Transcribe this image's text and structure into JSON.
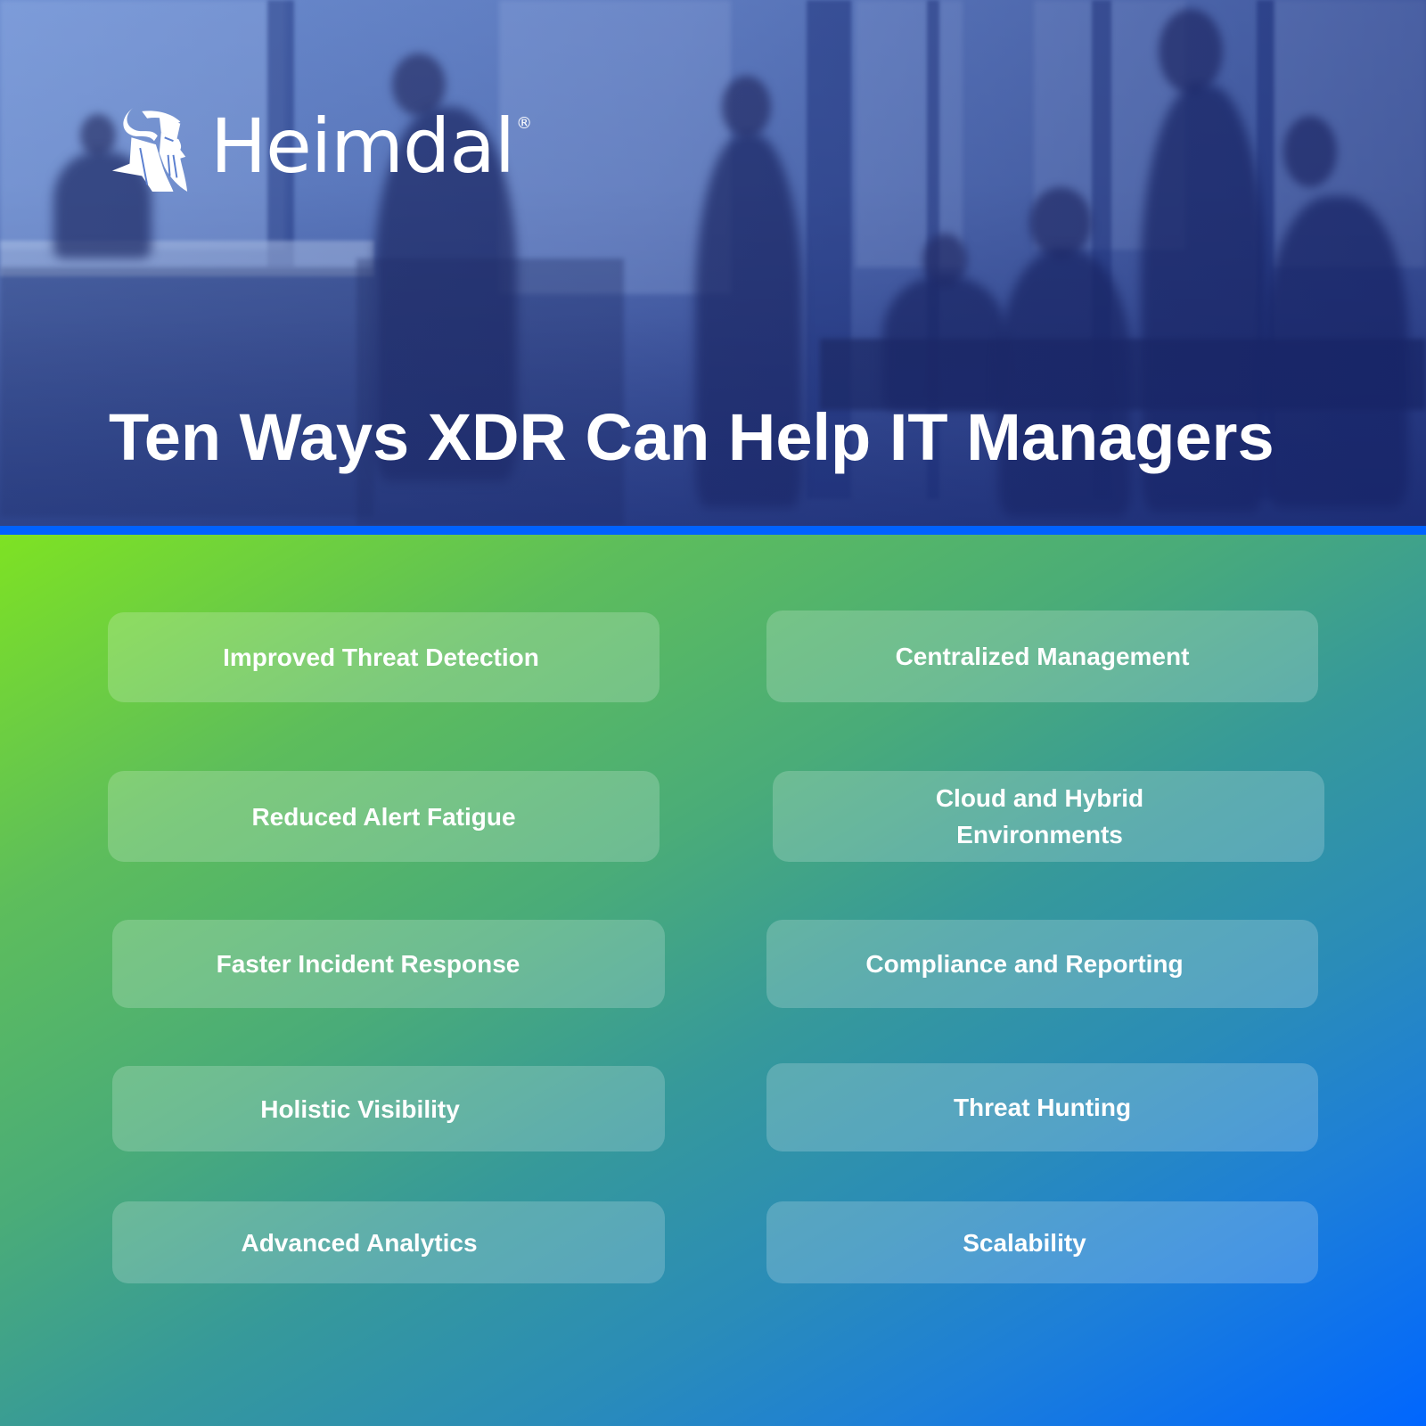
{
  "brand": {
    "name": "Heimdal",
    "registered_mark": "®",
    "logo_icon": "viking-head-icon"
  },
  "header": {
    "title": "Ten Ways XDR Can Help IT Managers"
  },
  "colors": {
    "accent_stripe": "#0062ff",
    "gradient_start": "#7ee223",
    "gradient_end": "#0066ff",
    "text": "#ffffff"
  },
  "benefits": [
    {
      "label": "Improved Threat Detection"
    },
    {
      "label": "Centralized Management"
    },
    {
      "label": "Reduced Alert Fatigue"
    },
    {
      "label": "Cloud and Hybrid Environments",
      "lines": [
        "Cloud and Hybrid",
        "Environments"
      ]
    },
    {
      "label": "Faster Incident Response"
    },
    {
      "label": "Compliance and Reporting"
    },
    {
      "label": "Holistic Visibility"
    },
    {
      "label": "Threat Hunting"
    },
    {
      "label": "Advanced Analytics"
    },
    {
      "label": "Scalability"
    }
  ]
}
